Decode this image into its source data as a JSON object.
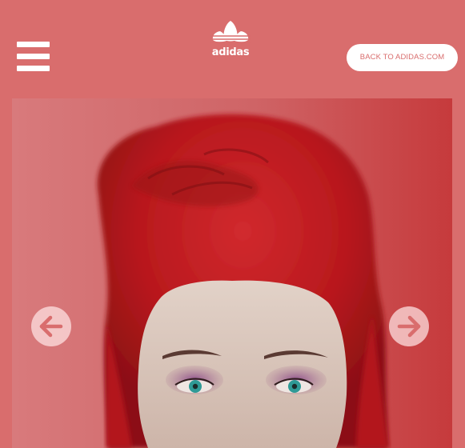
{
  "header": {
    "menu_icon": "hamburger-menu-icon",
    "logo_icon": "adidas-trefoil-logo",
    "logo_text": "adidas",
    "back_button_label": "BACK TO ADIDAS.COM"
  },
  "carousel": {
    "prev_icon": "arrow-left-icon",
    "next_icon": "arrow-right-icon",
    "image_subject": "portrait-red-hair-woman"
  },
  "colors": {
    "background": "#d96d6d",
    "button_bg": "#ffffff",
    "button_text": "#d96d6d",
    "hair": "#c01d22",
    "skin": "#d9c6bc"
  }
}
